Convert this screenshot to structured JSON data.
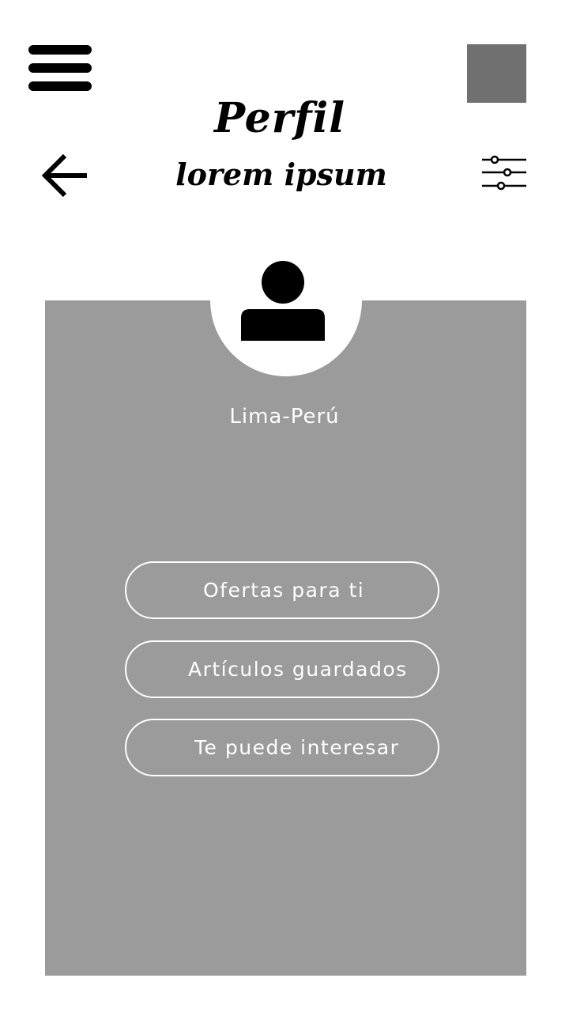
{
  "header": {
    "title": "Perfil",
    "subtitle": "lorem ipsum",
    "icons": {
      "menu": "hamburger-menu-icon",
      "back": "arrow-left-icon",
      "filter": "sliders-filter-icon",
      "square": "placeholder-square"
    }
  },
  "profile": {
    "avatar_icon": "user-icon",
    "location": "Lima-Perú"
  },
  "actions": [
    {
      "label": "Ofertas para ti"
    },
    {
      "label": "Artículos guardados"
    },
    {
      "label": "Te puede interesar"
    }
  ],
  "colors": {
    "background": "#ffffff",
    "card": "#9b9b9b",
    "square": "#707070",
    "text_light": "#ffffff",
    "icon": "#000000"
  }
}
